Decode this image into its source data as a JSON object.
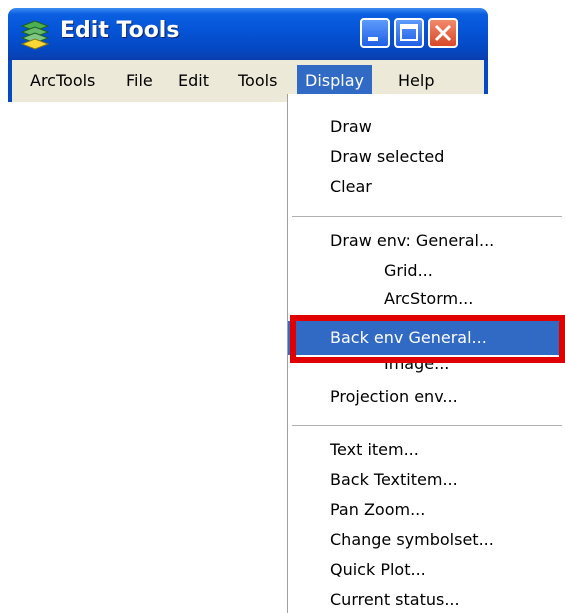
{
  "window": {
    "title": "Edit Tools",
    "icon": "stacked-layers-icon",
    "controls": [
      "minimize-icon",
      "maximize-icon",
      "close-icon"
    ]
  },
  "menubar": {
    "items": [
      "ArcTools",
      "File",
      "Edit",
      "Tools",
      "Display",
      "Help"
    ],
    "active": "Display"
  },
  "display_menu": {
    "items": [
      "Draw",
      "Draw selected",
      "Clear",
      "Draw env: General...",
      "Grid...",
      "ArcStorm...",
      "Back env  General...",
      "Image...",
      "Projection  env...",
      "Text item...",
      "Back Textitem...",
      "Pan Zoom...",
      "Change symbolset...",
      "Quick Plot...",
      "Current status..."
    ],
    "highlighted": "Back env  General..."
  },
  "colors": {
    "titlebar": "#0553d6",
    "menu_highlight": "#316ac5",
    "annotation_box": "#e00000",
    "menubar_bg": "#ece9d8"
  }
}
